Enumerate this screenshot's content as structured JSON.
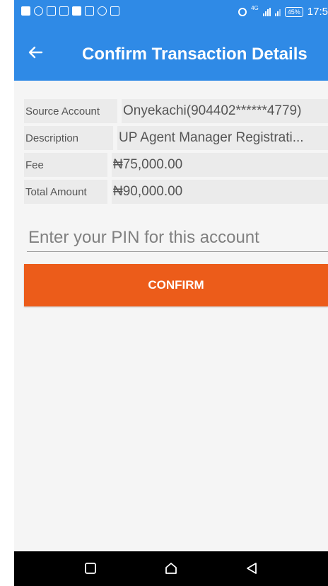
{
  "status_bar": {
    "network": "4G",
    "battery": "45%",
    "time": "17:5"
  },
  "app_bar": {
    "title": "Confirm Transaction Details"
  },
  "details": [
    {
      "label": "Source Account",
      "value": "Onyekachi(904402******4779)"
    },
    {
      "label": "Description",
      "value": "UP Agent Manager Registrati..."
    },
    {
      "label": "Fee",
      "value": "₦75,000.00"
    },
    {
      "label": "Total Amount",
      "value": "₦90,000.00"
    }
  ],
  "pin": {
    "placeholder": "Enter your PIN for this account",
    "value": ""
  },
  "confirm_label": "CONFIRM",
  "colors": {
    "primary": "#2f8ae6",
    "accent": "#ec5c1a",
    "row_bg": "#ebebeb",
    "background": "#f5f5f5"
  },
  "icons": {
    "back": "arrow-left-icon",
    "nav_recent": "square-icon",
    "nav_home": "home-icon",
    "nav_back": "triangle-left-icon"
  }
}
